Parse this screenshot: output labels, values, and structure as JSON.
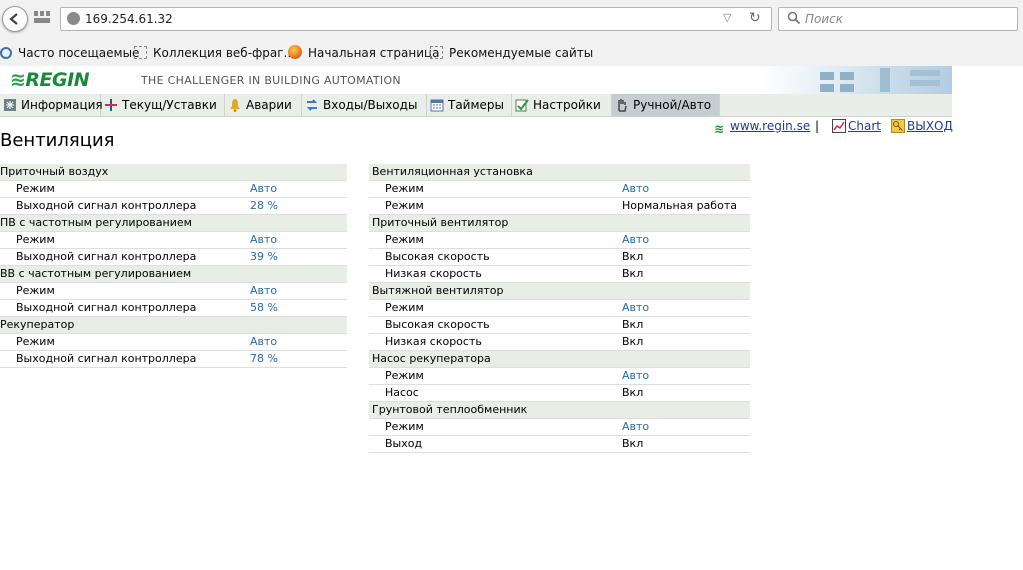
{
  "browser": {
    "url": "169.254.61.32",
    "search_placeholder": "Поиск",
    "bookmarks": [
      {
        "label": "Часто посещаемые",
        "icon": "magnifier-icon"
      },
      {
        "label": "Коллекция веб-фраг...",
        "icon": "blank-page-icon"
      },
      {
        "label": "Начальная страница",
        "icon": "firefox-icon"
      },
      {
        "label": "Рекомендуемые сайты",
        "icon": "blank-page-icon"
      }
    ]
  },
  "header": {
    "logo": "REGIN",
    "tagline": "THE CHALLENGER IN BUILDING AUTOMATION"
  },
  "tabs": [
    {
      "label": "Информация",
      "icon": "info-icon"
    },
    {
      "label": "Текущ/Уставки",
      "icon": "setpoint-icon"
    },
    {
      "label": "Аварии",
      "icon": "bell-icon"
    },
    {
      "label": "Входы/Выходы",
      "icon": "io-arrows-icon"
    },
    {
      "label": "Таймеры",
      "icon": "calendar-icon"
    },
    {
      "label": "Настройки",
      "icon": "settings-check-icon"
    },
    {
      "label": "Ручной/Авто",
      "icon": "hand-icon",
      "active": true
    }
  ],
  "links": {
    "regin": "www.regin.se",
    "separator": "|",
    "chart": "Chart",
    "logout": "ВЫХОД"
  },
  "page_title": "Вентиляция",
  "colors": {
    "value_link": "#2a6aa8",
    "header_row": "#e8ede6",
    "logo_green": "#1a8a3a",
    "active_tab": "#c5cdd1"
  },
  "left_table": [
    {
      "type": "head",
      "label": "Приточный воздух"
    },
    {
      "label": "Режим",
      "value": "Авто",
      "link": true
    },
    {
      "label": "Выходной сигнал контроллера",
      "value": "28 %",
      "link": true
    },
    {
      "type": "head",
      "label": "ПВ с частотным регулированием"
    },
    {
      "label": "Режим",
      "value": "Авто",
      "link": true
    },
    {
      "label": "Выходной сигнал контроллера",
      "value": "39 %",
      "link": true
    },
    {
      "type": "head",
      "label": "ВВ с частотным регулированием"
    },
    {
      "label": "Режим",
      "value": "Авто",
      "link": true
    },
    {
      "label": "Выходной сигнал контроллера",
      "value": "58 %",
      "link": true
    },
    {
      "type": "head",
      "label": "Рекуператор"
    },
    {
      "label": "Режим",
      "value": "Авто",
      "link": true
    },
    {
      "label": "Выходной сигнал контроллера",
      "value": "78 %",
      "link": true
    }
  ],
  "right_table": [
    {
      "type": "head",
      "label": "Вентиляционная установка"
    },
    {
      "label": "Режим",
      "value": "Авто",
      "link": true
    },
    {
      "label": "Режим",
      "value": "Нормальная работа",
      "link": false
    },
    {
      "type": "head",
      "label": "Приточный вентилятор"
    },
    {
      "label": "Режим",
      "value": "Авто",
      "link": true
    },
    {
      "label": "Высокая скорость",
      "value": "Вкл",
      "link": false
    },
    {
      "label": "Низкая скорость",
      "value": "Вкл",
      "link": false
    },
    {
      "type": "head",
      "label": "Вытяжной вентилятор"
    },
    {
      "label": "Режим",
      "value": "Авто",
      "link": true
    },
    {
      "label": "Высокая скорость",
      "value": "Вкл",
      "link": false
    },
    {
      "label": "Низкая скорость",
      "value": "Вкл",
      "link": false
    },
    {
      "type": "head",
      "label": "Насос рекуператора"
    },
    {
      "label": "Режим",
      "value": "Авто",
      "link": true
    },
    {
      "label": "Насос",
      "value": "Вкл",
      "link": false
    },
    {
      "type": "head",
      "label": "Грунтовой теплообменник"
    },
    {
      "label": "Режим",
      "value": "Авто",
      "link": true
    },
    {
      "label": "Выход",
      "value": "Вкл",
      "link": false
    }
  ]
}
